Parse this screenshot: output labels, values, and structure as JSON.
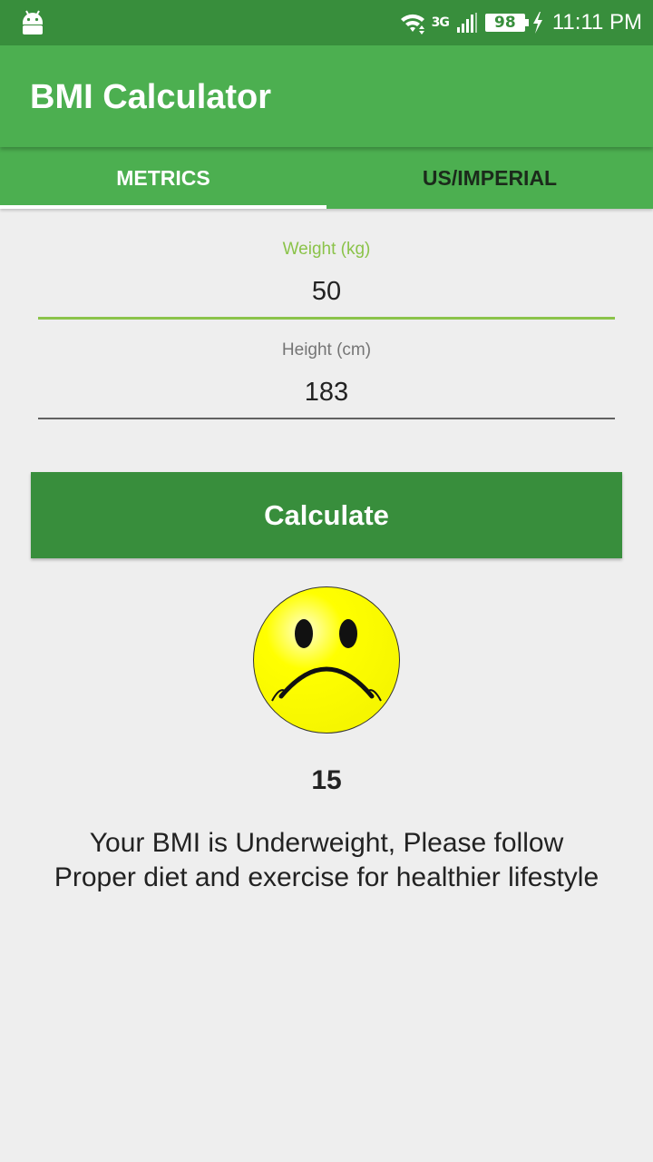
{
  "status_bar": {
    "time": "11:11 PM",
    "battery_level": "98",
    "network_type": "3G",
    "icons": [
      "android-icon",
      "wifi-icon",
      "signal-icon",
      "battery-icon",
      "charging-bolt-icon"
    ]
  },
  "app_bar": {
    "title": "BMI Calculator"
  },
  "tabs": [
    {
      "label": "METRICS",
      "active": true
    },
    {
      "label": "US/IMPERIAL",
      "active": false
    }
  ],
  "form": {
    "weight": {
      "label": "Weight (kg)",
      "value": "50"
    },
    "height": {
      "label": "Height (cm)",
      "value": "183"
    }
  },
  "button": {
    "label": "Calculate"
  },
  "result": {
    "icon": "sad-face-icon",
    "bmi_value": "15",
    "message_line1": "Your BMI is Underweight, Please follow",
    "message_line2": "Proper diet and exercise for healthier lifestyle"
  },
  "colors": {
    "status_bar": "#388e3c",
    "app_bar": "#4caf50",
    "button": "#388e3c",
    "accent": "#8bc34a",
    "background": "#eeeeee",
    "smiley_face": "#ffff00"
  }
}
